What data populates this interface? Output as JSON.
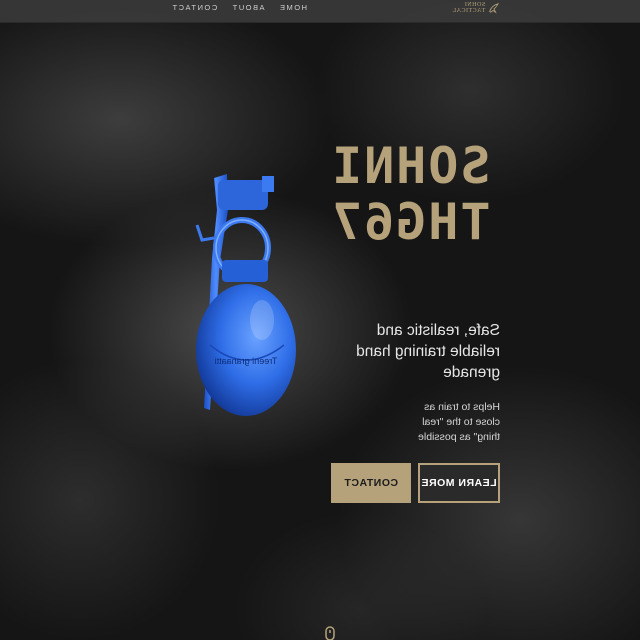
{
  "nav": {
    "links": [
      "HOME",
      "ABOUT",
      "CONTACT"
    ],
    "logo_line1": "SOHNI",
    "logo_line2": "TACTICAL"
  },
  "hero": {
    "title_line1": "SOHNI",
    "title_line2": "THG67",
    "subtitle": "Safe, realistic and reliable training hand grenade",
    "note": "Helps to train as close to the \"real thing\" as possible",
    "learn_more_label": "LEARN MORE",
    "contact_label": "CONTACT",
    "grenade_label": "Treeni granaatti"
  },
  "colors": {
    "accent": "#b5a27a",
    "background": "#1c1c1c",
    "grenade": "#2f6ee8"
  },
  "icons": {
    "logo": "eagle-logo-icon",
    "scroll": "scroll-down-icon"
  }
}
